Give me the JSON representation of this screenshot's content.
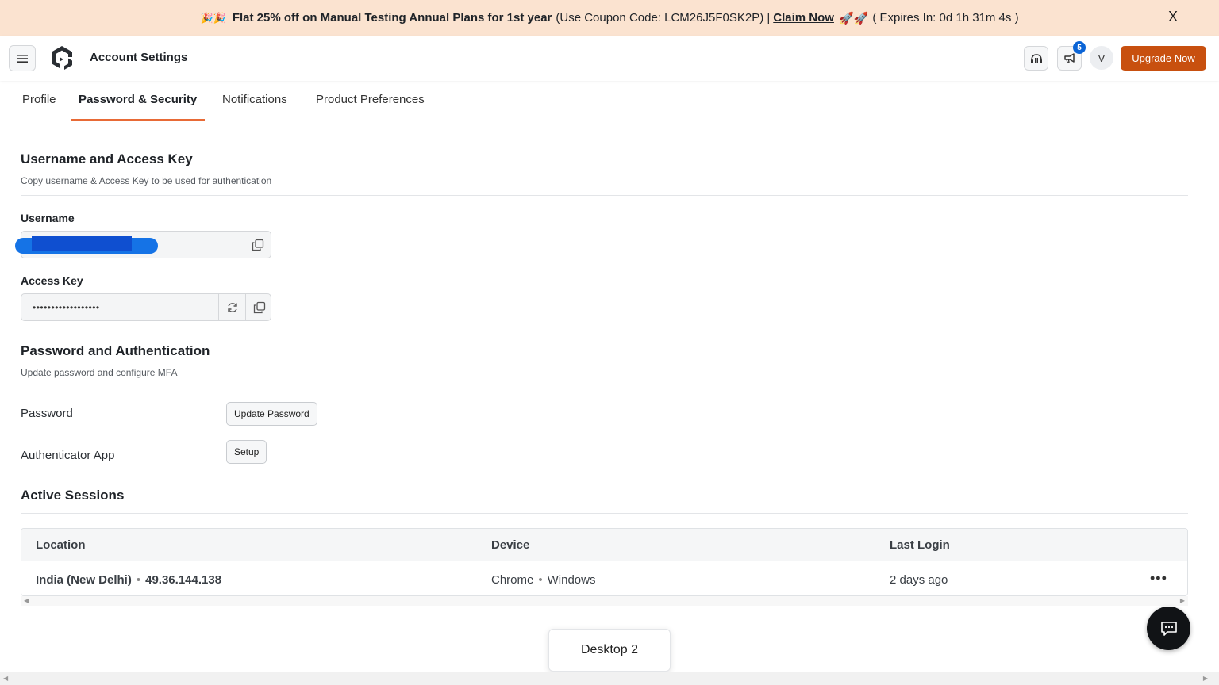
{
  "promo": {
    "emoji": "🎉🎉",
    "headline": "Flat 25% off on Manual Testing Annual Plans for 1st year",
    "coupon_text": "(Use Coupon Code: LCM26J5F0SK2P) |",
    "claim_label": "Claim Now",
    "rocket_emoji": "🚀🚀",
    "expiry": "( Expires In: 0d 1h 31m 4s )",
    "close_label": "X"
  },
  "header": {
    "title": "Account Settings",
    "notification_count": "5",
    "avatar_initial": "V",
    "upgrade_label": "Upgrade Now",
    "accent_color": "#c8500f"
  },
  "tabs": [
    {
      "label": "Profile"
    },
    {
      "label": "Password & Security",
      "active": true
    },
    {
      "label": "Notifications"
    },
    {
      "label": "Product Preferences"
    }
  ],
  "access": {
    "title": "Username and Access Key",
    "subtitle": "Copy username & Access Key to be used for authentication",
    "username_label": "Username",
    "access_key_label": "Access Key",
    "access_key_value": "••••••••••••••••••"
  },
  "password": {
    "title": "Password and Authentication",
    "subtitle": "Update password and configure MFA",
    "password_label": "Password",
    "update_password_label": "Update Password",
    "authenticator_label": "Authenticator App",
    "setup_label": "Setup"
  },
  "sessions": {
    "title": "Active Sessions",
    "columns": [
      "Location",
      "Device",
      "Last Login"
    ],
    "rows": [
      {
        "location": "India (New Delhi)",
        "ip": "49.36.144.138",
        "browser": "Chrome",
        "os": "Windows",
        "last_login": "2 days ago"
      }
    ]
  },
  "desktop_label": "Desktop 2"
}
